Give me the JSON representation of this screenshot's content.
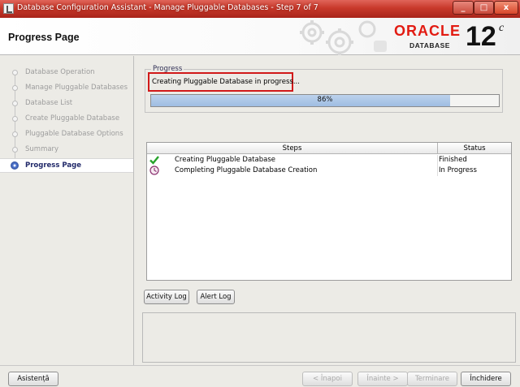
{
  "window": {
    "title": "Database Configuration Assistant - Manage Pluggable Databases - Step 7 of 7",
    "minimize": "_",
    "maximize": "□",
    "close": "x"
  },
  "header": {
    "page_title": "Progress Page",
    "brand": "ORACLE",
    "brand_sub": "DATABASE",
    "version": "12",
    "version_suffix": "c",
    "brand_color": "#e21b12"
  },
  "nav": {
    "items": [
      {
        "label": "Database Operation",
        "state": "done"
      },
      {
        "label": "Manage Pluggable Databases",
        "state": "done"
      },
      {
        "label": "Database List",
        "state": "done"
      },
      {
        "label": "Create Pluggable Database",
        "state": "done"
      },
      {
        "label": "Pluggable Database Options",
        "state": "done"
      },
      {
        "label": "Summary",
        "state": "done"
      },
      {
        "label": "Progress Page",
        "state": "current"
      }
    ]
  },
  "progress": {
    "group_label": "Progress",
    "status_text": "Creating Pluggable Database in progress...",
    "percent_value": 86,
    "percent_label": "86%"
  },
  "steps_table": {
    "headers": [
      "Steps",
      "Status"
    ],
    "rows": [
      {
        "icon": "check-icon",
        "step": "Creating Pluggable Database",
        "status": "Finished"
      },
      {
        "icon": "clock-icon",
        "step": "Completing Pluggable Database Creation",
        "status": "In Progress"
      }
    ]
  },
  "log_buttons": {
    "activity": "Activity Log",
    "alert": "Alert Log"
  },
  "footer": {
    "help": "Asistență",
    "back": "< Înapoi",
    "next": "Înainte >",
    "finish": "Terminare",
    "close": "Închidere"
  }
}
